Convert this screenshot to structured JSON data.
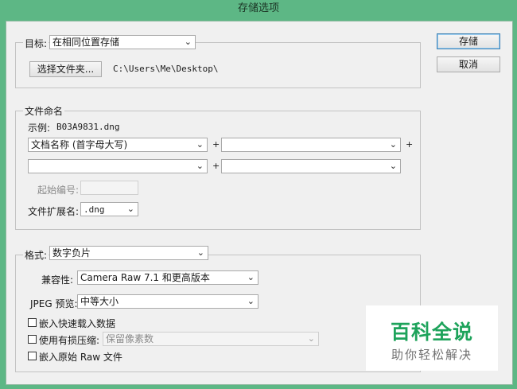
{
  "window": {
    "title": "存储选项"
  },
  "buttons": {
    "save": "存储",
    "cancel": "取消"
  },
  "target": {
    "label": "目标:",
    "selected": "在相同位置存储",
    "choose_folder": "选择文件夹...",
    "path": "C:\\Users\\Me\\Desktop\\"
  },
  "naming": {
    "legend": "文件命名",
    "example_label": "示例:",
    "example_value": "B03A9831.dng",
    "field1": "文档名称 (首字母大写)",
    "field2": "",
    "field3": "",
    "field4": "",
    "plus": "+",
    "start_number_label": "起始编号:",
    "start_number_value": "",
    "extension_label": "文件扩展名:",
    "extension_value": ".dng"
  },
  "format": {
    "label": "格式:",
    "selected": "数字负片",
    "compat_label": "兼容性:",
    "compat_value": "Camera Raw 7.1 和更高版本",
    "jpeg_label": "JPEG 预览:",
    "jpeg_value": "中等大小",
    "fast_load": "嵌入快速载入数据",
    "lossy": "使用有损压缩:",
    "lossy_value": "保留像素数",
    "embed_raw": "嵌入原始 Raw 文件"
  },
  "watermark": {
    "title": "百科全说",
    "subtitle": "助你轻松解决",
    "color": "#1ea35b"
  }
}
